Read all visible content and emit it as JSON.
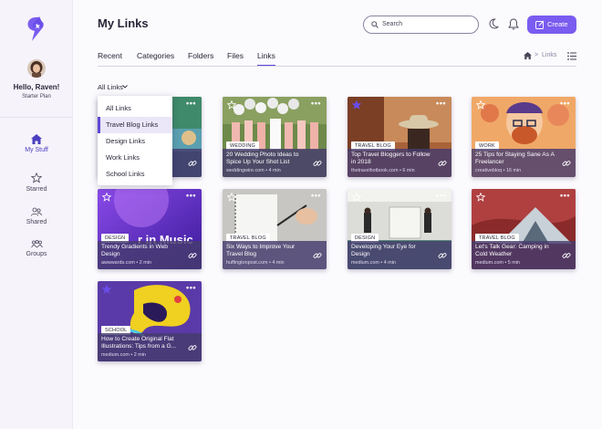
{
  "sidebar": {
    "user_greeting": "Hello, Raven!",
    "plan": "Starter Plan",
    "nav": [
      {
        "label": "My Stuff",
        "icon": "home-icon",
        "active": true
      },
      {
        "label": "Starred",
        "icon": "star-icon"
      },
      {
        "label": "Shared",
        "icon": "people-icon"
      },
      {
        "label": "Groups",
        "icon": "group-icon"
      }
    ]
  },
  "header": {
    "title": "My Links",
    "search_placeholder": "Search",
    "create_label": "Create"
  },
  "tabs": [
    {
      "label": "Recent"
    },
    {
      "label": "Categories"
    },
    {
      "label": "Folders"
    },
    {
      "label": "Files"
    },
    {
      "label": "Links",
      "active": true
    }
  ],
  "breadcrumb": {
    "current": "Links",
    "separator": ">"
  },
  "filter": {
    "selected": "All Links",
    "options": [
      "All Links",
      "Travel Blog Links",
      "Design Links",
      "Work Links",
      "School Links"
    ],
    "highlighted": "Travel Blog Links"
  },
  "cards": [
    {
      "badge": "",
      "title": "",
      "meta": "",
      "starred": false,
      "hidden": true
    },
    {
      "badge": "WEDDING",
      "title": "20 Wedding Photo Ideas to Spice Up Your Shot List",
      "meta": "weddingwire.com • 4 min",
      "starred": false
    },
    {
      "badge": "TRAVEL BLOG",
      "title": "Top Travel Bloggers to Follow in 2018",
      "meta": "thetravelhotbook.com • 6 min",
      "starred": true
    },
    {
      "badge": "WORK",
      "title": "25 Tips for Staying Sane As A Freelancer",
      "meta": "creativebloq • 16 min",
      "starred": false
    },
    {
      "badge": "DESIGN",
      "title": "Trendy Gradients in Web Design",
      "meta": "awwwards.com • 2 min",
      "starred": false
    },
    {
      "badge": "TRAVEL BLOG",
      "title": "Six Ways to Improve Your Travel Blog",
      "meta": "huffingtonpost.com • 4 min",
      "starred": false
    },
    {
      "badge": "DESIGN",
      "title": "Developing Your Eye for Design",
      "meta": "medium.com • 4 min",
      "starred": false
    },
    {
      "badge": "TRAVEL BLOG",
      "title": "Let's Talk Gear: Camping in Cold Weather",
      "meta": "medium.com • 5 min",
      "starred": false
    },
    {
      "badge": "SCHOOL",
      "title": "How to Create Original Flat Illustrations: Tips from a G...",
      "meta": "medium.com • 2 min",
      "starred": true
    }
  ],
  "card_image_text": "r in Music",
  "colors": {
    "accent": "#7a5cf0",
    "brand": "#5e47d6"
  }
}
